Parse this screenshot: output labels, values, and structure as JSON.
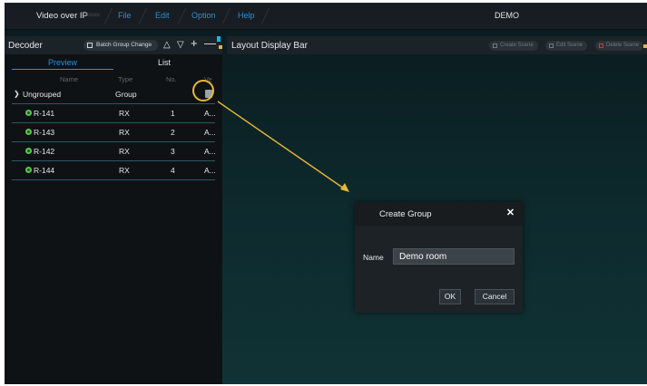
{
  "menu": {
    "app_name": "Video over IP",
    "app_suffix": "xxxxx",
    "items": [
      {
        "label": "File"
      },
      {
        "label": "Edit"
      },
      {
        "label": "Option"
      },
      {
        "label": "Help"
      }
    ],
    "title": "DEMO"
  },
  "decoder_panel": {
    "title": "Decoder",
    "batch_button": "Batch Group Change",
    "icons": [
      "chevron-up-icon",
      "chevron-down-icon",
      "plus-icon",
      "minus-icon"
    ],
    "tabs": {
      "preview": "Preview",
      "list": "List"
    },
    "columns": {
      "name": "Name",
      "type": "Type",
      "no": "No.",
      "ver": "Ve"
    },
    "group_row": {
      "name": "Ungrouped",
      "type": "Group"
    },
    "devices": [
      {
        "name": "R-141",
        "type": "RX",
        "no": "1",
        "ver": "A..."
      },
      {
        "name": "R-143",
        "type": "RX",
        "no": "2",
        "ver": "A..."
      },
      {
        "name": "R-142",
        "type": "RX",
        "no": "3",
        "ver": "A..."
      },
      {
        "name": "R-144",
        "type": "RX",
        "no": "4",
        "ver": "A..."
      }
    ]
  },
  "layout_panel": {
    "title": "Layout Display Bar",
    "create_scene": "Create Scene",
    "edit_scene": "Edit Scene",
    "delete_scene": "Delete Scene"
  },
  "dialog": {
    "title": "Create Group",
    "name_label": "Name",
    "name_value": "Demo room",
    "ok_label": "OK",
    "cancel_label": "Cancel"
  },
  "colors": {
    "accent": "#2f8fd6",
    "highlight": "#e5b73a",
    "online": "#56c94e"
  }
}
